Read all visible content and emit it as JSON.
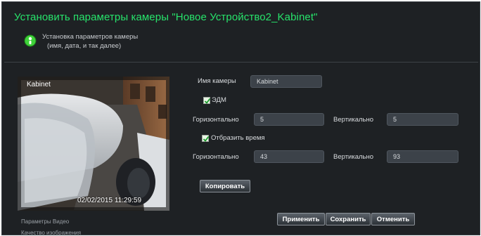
{
  "window": {
    "title": "Установить параметры камеры \"Новое Устройство2_Kabinet\"",
    "subtitle_line1": "Установка параметров камеры",
    "subtitle_line2": "(имя, дата, и так далее)"
  },
  "preview": {
    "camera_label": "Kabinet",
    "timestamp": "02/02/2015 11:29:59"
  },
  "settings": {
    "camera_name_label": "Имя камеры",
    "camera_name_value": "Kabinet",
    "osd_checkbox_label": "ЭДМ",
    "osd_checked": true,
    "osd_horizontal_label": "Горизонтально",
    "osd_horizontal_value": "5",
    "osd_vertical_label": "Вертикально",
    "osd_vertical_value": "5",
    "time_checkbox_label": "Отбразить время",
    "time_checked": true,
    "time_horizontal_label": "Горизонтально",
    "time_horizontal_value": "43",
    "time_vertical_label": "Вертикально",
    "time_vertical_value": "93",
    "copy_button": "Копировать"
  },
  "sidebar": {
    "items": [
      "Параметры Видео",
      "Качество изображения"
    ]
  },
  "footer": {
    "apply_button": "Применить",
    "save_button": "Сохранить",
    "cancel_button": "Отменить"
  },
  "colors": {
    "title": "#27e36b",
    "background": "#1e2124",
    "field": "#3c4249"
  },
  "icons": {
    "subtitle_icon": "green-info-icon",
    "checkbox_mark": "checkmark-icon"
  }
}
